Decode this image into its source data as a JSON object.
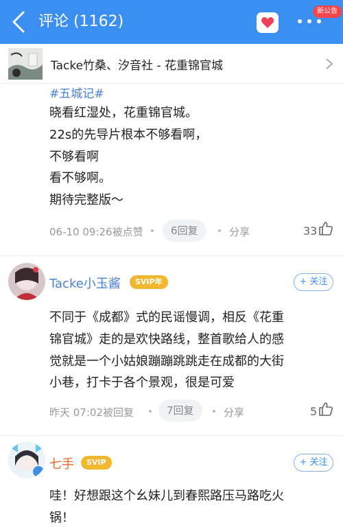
{
  "header": {
    "title": "评论 (1162)",
    "badge": "新公告",
    "bg_color": "#3b8ff0"
  },
  "song": {
    "title": "Tacke竹桑、汐音社 - 花重锦官城"
  },
  "comments": [
    {
      "tag": "#五城记#",
      "lines": [
        "晓看红湿处，花重锦官城。",
        "22s的先导片根本不够看啊，",
        "不够看啊",
        "看不够啊。",
        "期待完整版～"
      ],
      "time": "06-10 09:26被点赞",
      "replies": "6回复",
      "share": "分享",
      "likes": "33"
    },
    {
      "user": "Tacke小玉酱",
      "vip": "SVIP年",
      "follow": "+ 关注",
      "lines": [
        "不同于《成都》式的民谣慢调，相反《花重",
        "锦官城》走的是欢快路线，整首歌给人的感",
        "觉就是一个小姑娘蹦蹦跳跳走在成都的大街",
        "小巷，打卡于各个景观，很是可爱"
      ],
      "time": "昨天 07:02被回复",
      "replies": "7回复",
      "share": "分享",
      "likes": "5"
    },
    {
      "user": "七手",
      "vip": "SVIP",
      "follow": "+ 关注",
      "lines": [
        "哇！好想跟这个幺妹儿到春熙路压马路吃火",
        "锅！"
      ]
    }
  ]
}
